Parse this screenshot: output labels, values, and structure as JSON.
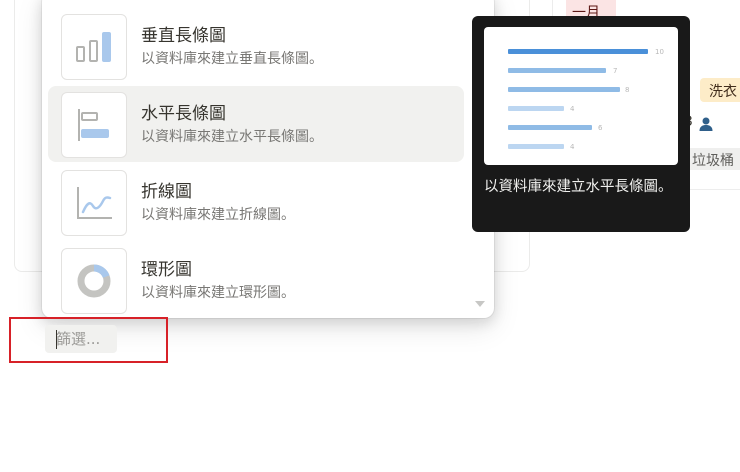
{
  "background": {
    "top_tag": "一月",
    "wash_tag": "洗衣",
    "count": "3",
    "trash_tag": "垃圾桶"
  },
  "menu": {
    "items": [
      {
        "title": "垂直長條圖",
        "description": "以資料庫來建立垂直長條圖。",
        "icon": "vertical-bar-chart-icon",
        "highlighted": false
      },
      {
        "title": "水平長條圖",
        "description": "以資料庫來建立水平長條圖。",
        "icon": "horizontal-bar-chart-icon",
        "highlighted": true
      },
      {
        "title": "折線圖",
        "description": "以資料庫來建立折線圖。",
        "icon": "line-chart-icon",
        "highlighted": false
      },
      {
        "title": "環形圖",
        "description": "以資料庫來建立環形圖。",
        "icon": "donut-chart-icon",
        "highlighted": false
      }
    ]
  },
  "tooltip": {
    "description": "以資料庫來建立水平長條圖。",
    "preview_values": [
      "10",
      "7",
      "8",
      "4",
      "6",
      "4"
    ]
  },
  "filter": {
    "value": "/",
    "placeholder": "篩選..."
  },
  "colors": {
    "highlight": "#f1f1ef",
    "accent_blue": "#5b9bd5",
    "tooltip_bg": "#191919",
    "focus_border": "#d72128"
  }
}
